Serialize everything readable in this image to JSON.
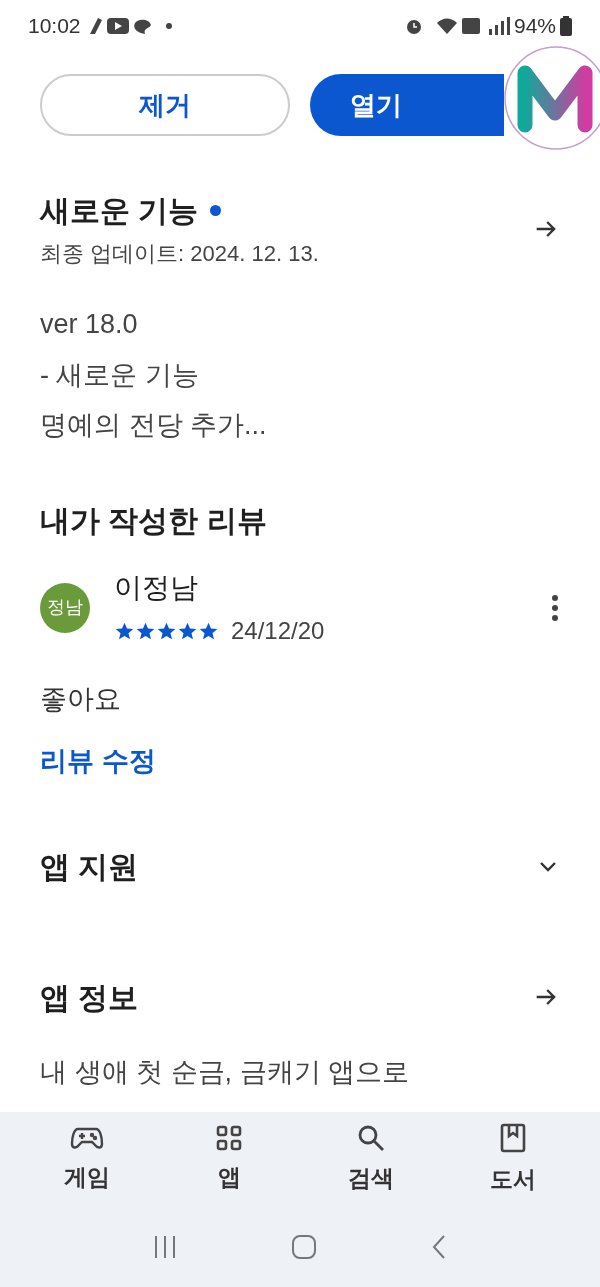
{
  "status_bar": {
    "time": "10:02",
    "battery": "94%"
  },
  "actions": [
    {
      "label": "제거",
      "kind": "outline"
    },
    {
      "label": "열기",
      "kind": "filled"
    }
  ],
  "whats_new": {
    "title": "새로운 기능",
    "new_dot": true,
    "updated": "최종 업데이트: 2024. 12. 13.",
    "lines": [
      "ver 18.0",
      "- 새로운 기능",
      "명예의 전당 추가..."
    ]
  },
  "my_review": {
    "title": "내가 작성한 리뷰",
    "avatar": "정남",
    "author": "이정남",
    "stars": 5,
    "date": "24/12/20",
    "text": "좋아요",
    "edit_link": "리뷰 수정"
  },
  "app_support": {
    "title": "앱 지원",
    "expanded": false
  },
  "app_info": {
    "title": "앱 정보",
    "description": "내 생애 첫 순금, 금캐기 앱으로"
  },
  "bottom_nav": [
    {
      "label": "게임",
      "kind": "games",
      "selected": false
    },
    {
      "label": "앱",
      "kind": "apps",
      "selected": false
    },
    {
      "label": "검색",
      "kind": "search",
      "selected": false
    },
    {
      "label": "도서",
      "kind": "books",
      "selected": false
    }
  ]
}
